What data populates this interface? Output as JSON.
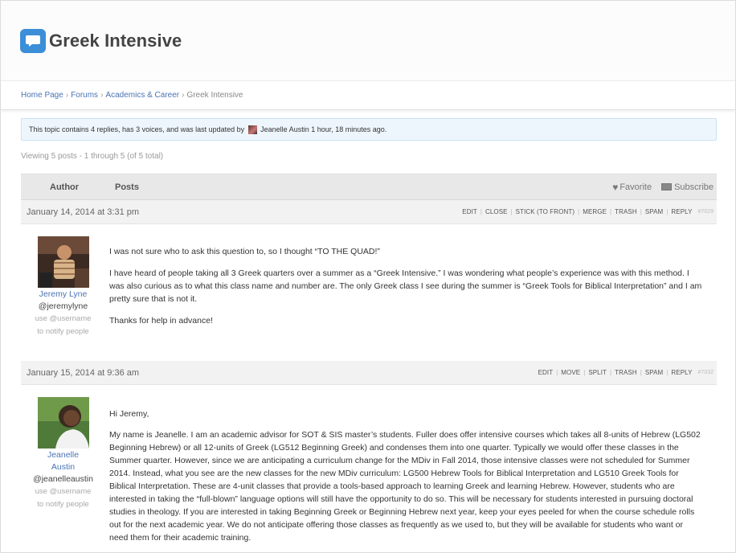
{
  "site": {
    "title": "Greek Intensive",
    "logo_icon": "speech-bubble-icon",
    "accent": "#3b8ed8"
  },
  "breadcrumb": {
    "items": [
      "Home Page",
      "Forums",
      "Academics & Career"
    ],
    "separator": "›",
    "current": "Greek Intensive"
  },
  "notice": {
    "prefix": "This topic contains 4 replies, has 3 voices, and was last updated by",
    "user": "Jeanelle Austin",
    "time": "1 hour, 18 minutes ago."
  },
  "viewing": "Viewing 5 posts - 1 through 5 (of 5 total)",
  "table_header": {
    "author": "Author",
    "posts": "Posts",
    "favorite": "Favorite",
    "subscribe": "Subscribe"
  },
  "posts": [
    {
      "date": "January 14, 2014 at 3:31 pm",
      "admin": [
        "EDIT",
        "CLOSE",
        "STICK (TO FRONT)",
        "MERGE",
        "TRASH",
        "SPAM",
        "REPLY"
      ],
      "id": "#7029",
      "author_name": "Jeremy Lyne",
      "handle": "@jeremylyne",
      "hint1": "use @username",
      "hint2": "to notify people",
      "paragraphs": [
        "I was not sure who to ask this question to, so I thought “TO THE QUAD!”",
        "I have heard of people taking all 3 Greek quarters over a summer as a “Greek Intensive.” I was wondering what people’s experience was with this method. I was also curious as to what this class name and number are. The only Greek class I see during the summer is “Greek Tools for Biblical Interpretation” and I am pretty sure that is not it.",
        "Thanks for help in advance!"
      ]
    },
    {
      "date": "January 15, 2014 at 9:36 am",
      "admin": [
        "EDIT",
        "MOVE",
        "SPLIT",
        "TRASH",
        "SPAM",
        "REPLY"
      ],
      "id": "#7032",
      "author_name_1": "Jeanelle",
      "author_name_2": "Austin",
      "handle": "@jeanelleaustin",
      "hint1": "use @username",
      "hint2": "to notify people",
      "paragraphs": [
        "Hi Jeremy,",
        "My name is Jeanelle. I am an academic advisor for SOT & SIS master’s students. Fuller does offer intensive courses which takes all 8-units of Hebrew (LG502 Beginning Hebrew) or all 12-units of Greek (LG512 Beginning Greek) and condenses them into one quarter. Typically we would offer these classes in the Summer quarter. However, since we are anticipating a curriculum change for the MDiv in Fall 2014, those intensive classes were not scheduled for Summer 2014. Instead, what you see are the new classes for the new MDiv curriculum: LG500 Hebrew Tools for Biblical Interpretation and LG510 Greek Tools for Biblical Interpretation. These are 4-unit classes that provide a tools-based approach to learning Greek and learning Hebrew. However, students who are interested in taking the “full-blown” language options will still have the opportunity to do so. This will be necessary for students interested in pursuing doctoral studies in theology. If you are interested in taking Beginning Greek or Beginning Hebrew next year, keep your eyes peeled for when the course schedule rolls out for the next academic year. We do not anticipate offering those classes as frequently as we used to, but they will be available for students who want or need them for their academic training."
      ]
    }
  ]
}
